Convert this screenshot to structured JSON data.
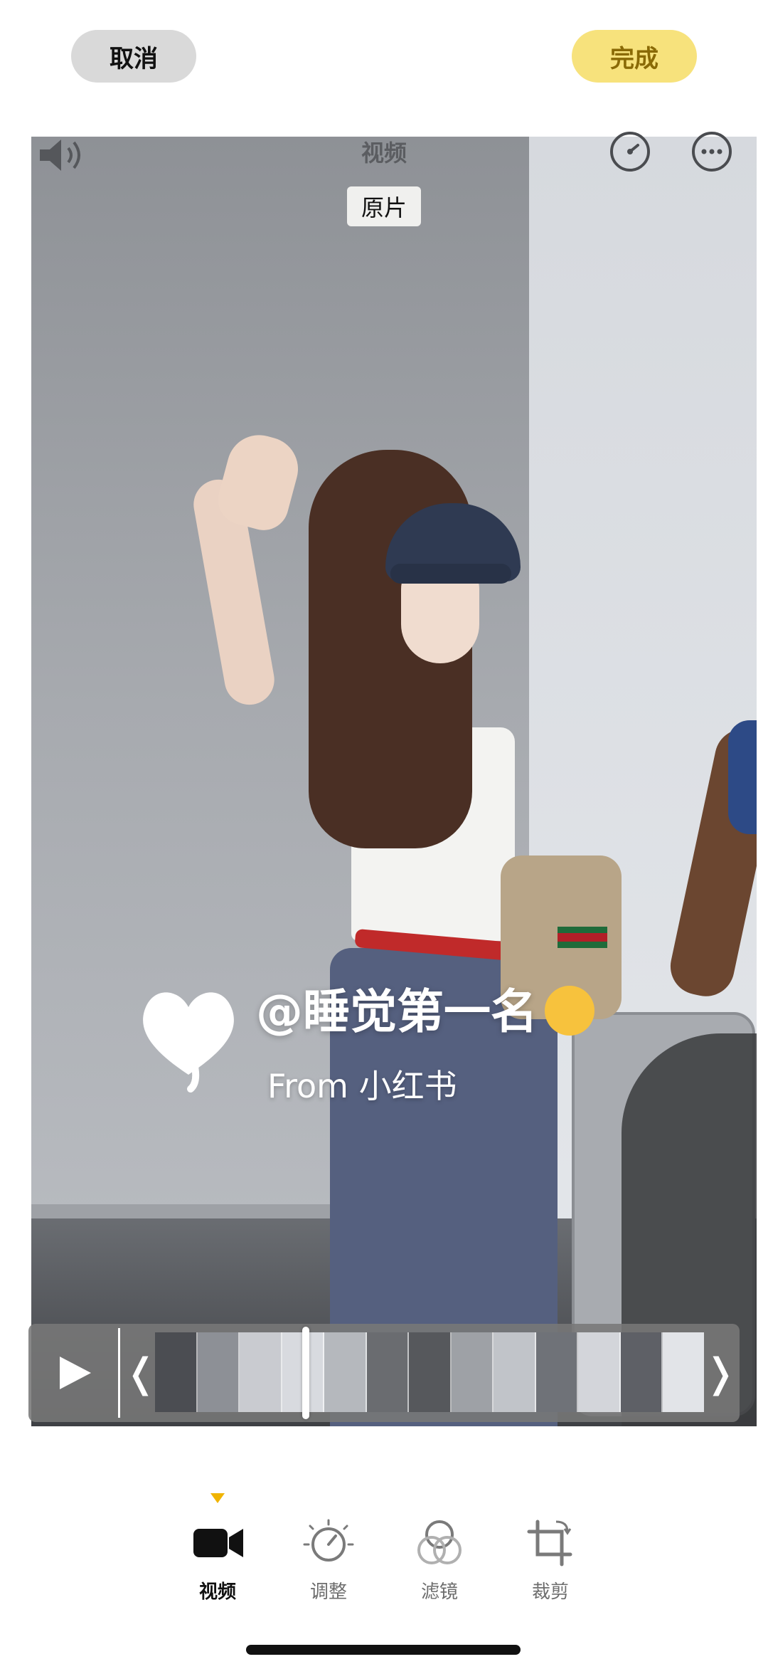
{
  "header": {
    "cancel_label": "取消",
    "done_label": "完成"
  },
  "editor": {
    "mode_label": "视频",
    "original_tag": "原片"
  },
  "watermark": {
    "handle": "@睡觉第一名",
    "from": "From 小红书"
  },
  "toolbar": {
    "items": [
      {
        "label": "视频",
        "icon": "video-camera-icon",
        "active": true
      },
      {
        "label": "调整",
        "icon": "adjust-dial-icon",
        "active": false
      },
      {
        "label": "滤镜",
        "icon": "filters-circles-icon",
        "active": false
      },
      {
        "label": "裁剪",
        "icon": "crop-rotate-icon",
        "active": false
      }
    ]
  },
  "colors": {
    "done_button": "#f7e27c",
    "active_indicator": "#f0b400"
  }
}
